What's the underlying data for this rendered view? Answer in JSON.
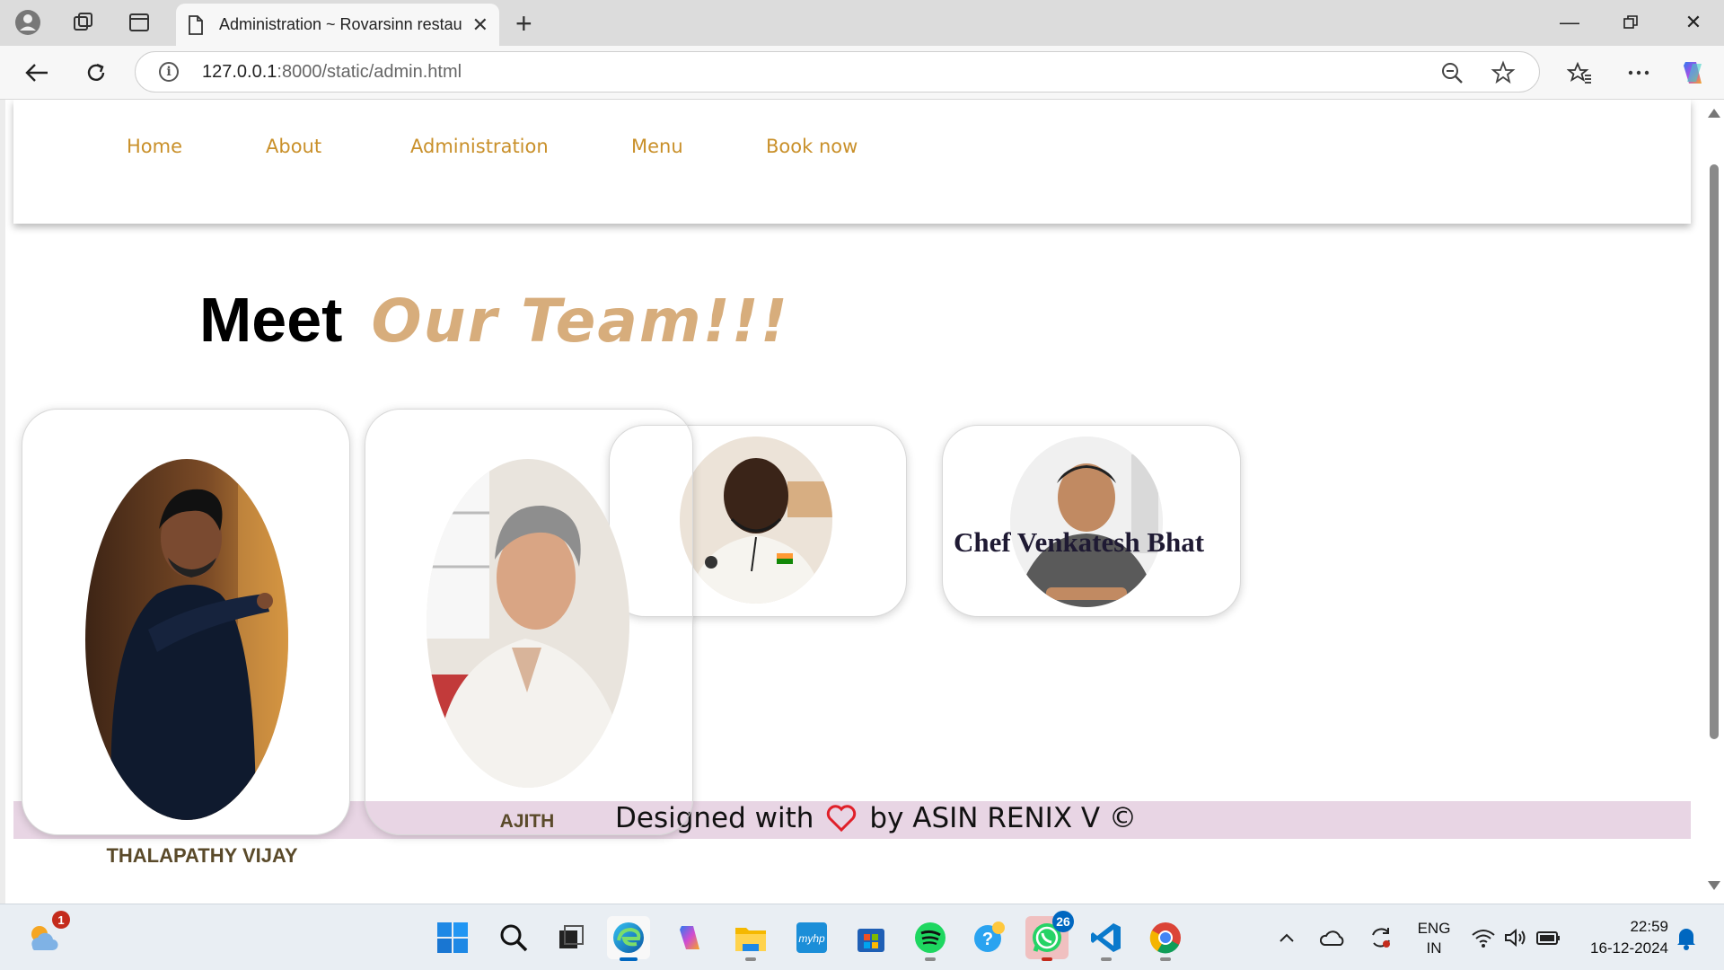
{
  "browser": {
    "tab_title": "Administration ~ Rovarsinn restau",
    "url_host": "127.0.0.1",
    "url_path": ":8000/static/admin.html"
  },
  "site": {
    "nav": [
      "Home",
      "About",
      "Administration",
      "Menu",
      "Book now"
    ],
    "heading_meet": "Meet",
    "heading_team": "Our Team!!!",
    "members": [
      {
        "name": "THALAPATHY VIJAY"
      },
      {
        "name": "AJITH"
      },
      {
        "name": ""
      },
      {
        "name": "Chef Venkatesh Bhat"
      }
    ],
    "footer_before": "Designed with",
    "footer_after": "by ASIN RENIX V ©"
  },
  "colors": {
    "nav_link": "#c9902a",
    "heading_accent": "#d7ad7c",
    "footer_bg": "#e8d5e4",
    "heart": "#e0202a"
  },
  "taskbar": {
    "weather_badge": "1",
    "whatsapp_badge": "26",
    "lang_line1": "ENG",
    "lang_line2": "IN",
    "time": "22:59",
    "date": "16-12-2024",
    "icons": [
      "windows-start-icon",
      "search-icon",
      "task-view-icon",
      "edge-icon",
      "copilot-icon",
      "file-explorer-icon",
      "myhp-icon",
      "store-icon",
      "spotify-icon",
      "help-icon",
      "whatsapp-icon",
      "vscode-icon",
      "chrome-icon"
    ]
  }
}
